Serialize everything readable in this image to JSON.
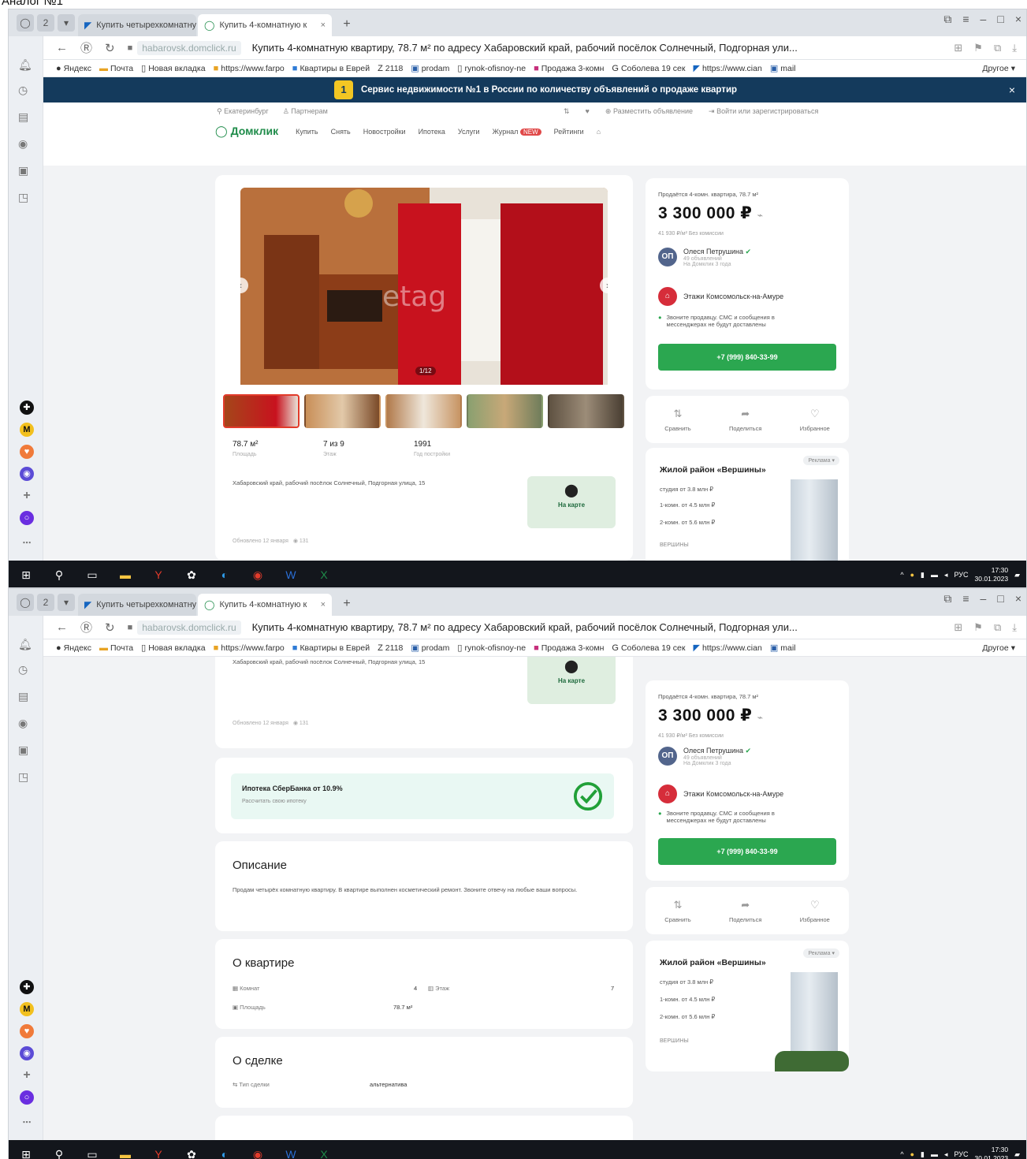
{
  "heading": "Аналог №1",
  "browser": {
    "tabs": [
      {
        "label": "Купить четырехкомнатную",
        "active": false
      },
      {
        "label": "Купить 4-комнатную к",
        "active": true
      }
    ],
    "tab_count": "2",
    "new_tab": "+",
    "page_title": "Купить 4-комнатную квартиру, 78.7 м² по адресу Хабаровский край, рабочий посёлок Солнечный, Подгорная ули...",
    "domain": "habarovsk.domclick.ru",
    "bookmarks": [
      "Яндекс",
      "Почта",
      "Новая вкладка",
      "https://www.farpo",
      "Квартиры в Еврей",
      "2118",
      "prodam",
      "rynok-ofisnoy-ne",
      "Продажа 3-комн",
      "Соболева 19 сек",
      "https://www.cian",
      "mail"
    ],
    "bookmarks_other": "Другое"
  },
  "banner": {
    "num": "1",
    "text": "Сервис недвижимости №1 в России по количеству объявлений о продаже квартир"
  },
  "site": {
    "city": "Екатеринбург",
    "partner": "Партнерам",
    "place_ad": "Разместить объявление",
    "login": "Войти или зарегистрироваться",
    "logo": "Домклик",
    "nav": [
      "Купить",
      "Снять",
      "Новостройки",
      "Ипотека",
      "Услуги",
      "Журнал",
      "Рейтинги"
    ],
    "journal_badge": "NEW"
  },
  "listing": {
    "photo_counter": "1/12",
    "area_value": "78.7 м²",
    "area_label": "Площадь",
    "floor_value": "7 из 9",
    "floor_label": "Этаж",
    "year_value": "1991",
    "year_label": "Год постройки",
    "address": "Хабаровский край, рабочий посёлок Солнечный, Подгорная улица, 15",
    "map_label": "На карте",
    "meta": "Обновлено 12 января",
    "views": "131"
  },
  "price_card": {
    "subtitle": "Продаётся 4-комн. квартира, 78.7 м²",
    "price": "3 300 000 ₽",
    "per_m2": "41 930 ₽/м²  Без комиссии",
    "agent_initials": "ОП",
    "agent_name": "Олеся Петрушина",
    "agent_ads": "49 объявлений",
    "agent_since": "На Домклик 3 года",
    "agency_name": "Этажи Комсомольск-на-Амуре",
    "warning": "Звоните продавцу. СМС и сообщения в мессенджерах не будут доставлены",
    "phone": "+7 (999) 840-33-99"
  },
  "actions": {
    "compare": "Сравнить",
    "share": "Поделиться",
    "favorite": "Избранное"
  },
  "ad": {
    "tag": "Реклама",
    "title": "Жилой район «Вершины»",
    "rows": [
      "студия от 3.8 млн ₽",
      "1-комн. от 4.5 млн ₽",
      "2-комн. от 5.6 млн ₽"
    ],
    "logo": "ВЕРШИНЫ"
  },
  "mortgage": {
    "title": "Ипотека СберБанка от 10.9%",
    "subtitle": "Рассчитать свою ипотеку"
  },
  "description": {
    "title": "Описание",
    "text": "Продам четырёх комнатную квартиру. В квартире выполнен косметический ремонт. Звоните отвечу на любые ваши вопросы."
  },
  "about": {
    "title": "О квартире",
    "rows_label": [
      "Комнат",
      "Этаж",
      "Площадь"
    ],
    "rows_value": [
      "4",
      "7",
      "78.7 м²"
    ]
  },
  "deal": {
    "title": "О сделке",
    "type_label": "Тип сделки",
    "type_value": "альтернатива"
  },
  "taskbar": {
    "lang": "РУС",
    "time": "17:30",
    "date": "30.01.2023"
  },
  "colors": {
    "banner": "#143a5c",
    "green": "#2ba750",
    "accent_red": "#e23b2b"
  }
}
